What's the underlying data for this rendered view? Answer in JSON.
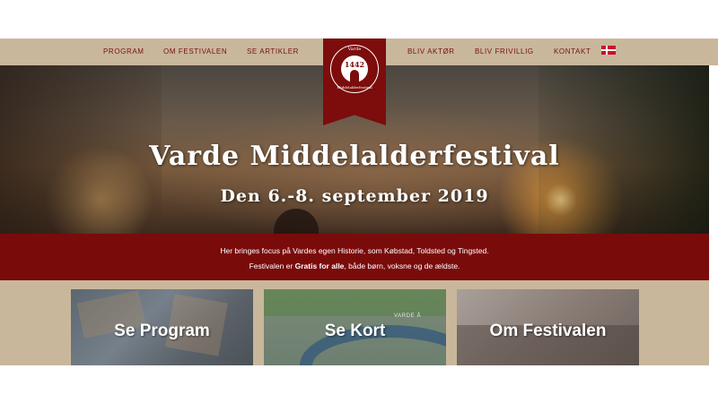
{
  "nav": {
    "left": [
      {
        "label": "PROGRAM"
      },
      {
        "label": "OM FESTIVALEN"
      },
      {
        "label": "SE ARTIKLER"
      }
    ],
    "right": [
      {
        "label": "BLIV AKTØR"
      },
      {
        "label": "BLIV FRIVILLIG"
      },
      {
        "label": "KONTAKT"
      }
    ],
    "language_flag": "danish-flag-icon"
  },
  "logo": {
    "year": "1442",
    "top_text": "Varde",
    "bottom_text": "Middelalderfestival",
    "left_text": "1442",
    "right_text": "2019"
  },
  "hero": {
    "title": "Varde Middelalderfestival",
    "date": "Den 6.-8. september 2019"
  },
  "info": {
    "line1": "Her bringes focus på Vardes egen Historie, som Købstad, Toldsted og Tingsted.",
    "line2_prefix": "Festivalen er ",
    "line2_bold": "Gratis for alle",
    "line2_suffix": ", både børn, voksne og de ældste."
  },
  "tiles": [
    {
      "label": "Se Program"
    },
    {
      "label": "Se Kort",
      "map_label": "VARDE Å"
    },
    {
      "label": "Om Festivalen"
    }
  ],
  "colors": {
    "brand_red": "#7a0b0b",
    "nav_bg": "#c9b79c",
    "nav_text": "#7a1010"
  }
}
